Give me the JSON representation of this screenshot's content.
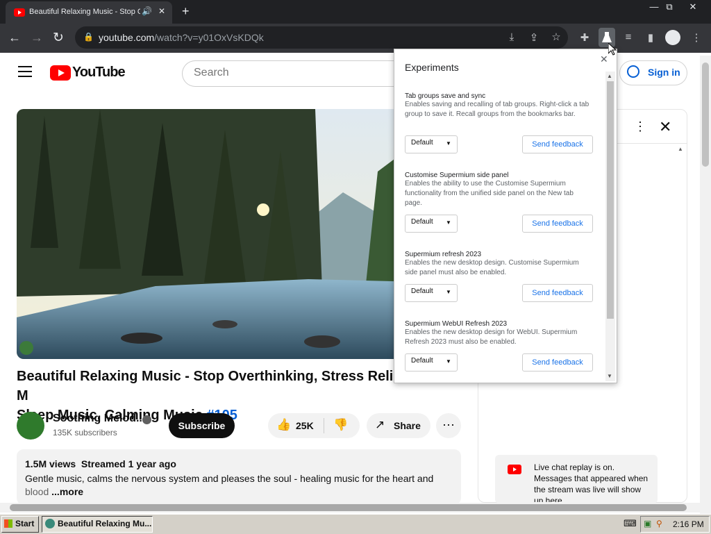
{
  "browser": {
    "tab_title": "Beautiful Relaxing Music - Stop Overthinking",
    "url_host": "youtube.com",
    "url_path": "/watch?v=y01OxVsKDQk",
    "window_min": "—",
    "window_restore": "⧉",
    "window_close": "✕"
  },
  "youtube": {
    "logo_text": "YouTube",
    "search_placeholder": "Search",
    "sign_in": "Sign in",
    "video_title": "Beautiful Relaxing Music - Stop Overthinking, Stress Relief M",
    "video_title_line2": "Sleep Music, Calming Music ",
    "hashtag": "#105",
    "channel_name": "Soothing Melod...",
    "subscribers": "135K subscribers",
    "subscribe": "Subscribe",
    "likes": "25K",
    "share": "Share",
    "views_line": "1.5M views  Streamed 1 year ago",
    "description": "Gentle music, calms the nervous system and pleases the soul - healing music for the heart and",
    "description_cont": "blood ",
    "more": "...more",
    "live_chat_text": "Live chat replay is on. Messages that appeared when the stream was live will show up here"
  },
  "experiments": {
    "title": "Experiments",
    "items": [
      {
        "title": "Tab groups save and sync",
        "desc": "Enables saving and recalling of tab groups. Right-click a tab group to save it. Recall groups from the bookmarks bar.",
        "value": "Default",
        "feedback": "Send feedback"
      },
      {
        "title": "Customise Supermium side panel",
        "desc": "Enables the ability to use the Customise Supermium functionality from the unified side panel on the New tab page.",
        "value": "Default",
        "feedback": "Send feedback"
      },
      {
        "title": "Supermium refresh 2023",
        "desc": "Enables the new desktop design. Customise Supermium side panel must also be enabled.",
        "value": "Default",
        "feedback": "Send feedback"
      },
      {
        "title": "Supermium WebUI Refresh 2023",
        "desc": "Enables the new desktop design for WebUI. Supermium Refresh 2023 must also be enabled.",
        "value": "Default",
        "feedback": "Send feedback"
      }
    ]
  },
  "taskbar": {
    "start": "Start",
    "task_item": "Beautiful Relaxing Mu...",
    "clock": "2:16 PM"
  },
  "colors": {
    "youtube_red": "#ff0000",
    "link_blue": "#065fd4",
    "chrome_dark": "#35363a"
  }
}
